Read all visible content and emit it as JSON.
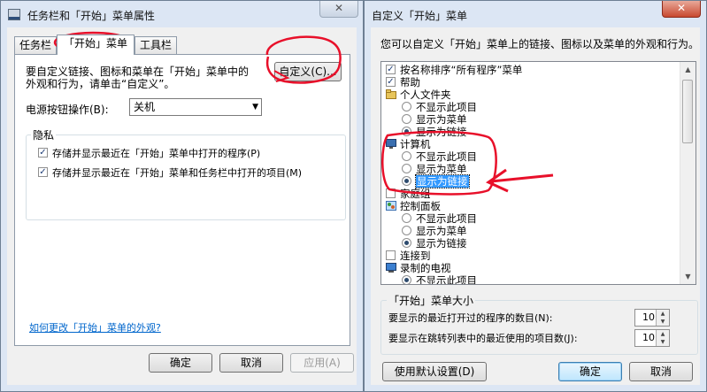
{
  "taskbar_props": {
    "title": "任务栏和「开始」菜单属性",
    "close": "✕",
    "tabs": [
      {
        "label": "任务栏",
        "active": false
      },
      {
        "label": "「开始」菜单",
        "active": true
      },
      {
        "label": "工具栏",
        "active": false
      }
    ],
    "customize_desc": "要自定义链接、图标和菜单在「开始」菜单中的外观和行为，请单击“自定义”。",
    "customize_desc_line1": "要自定义链接、图标和菜单在「开始」菜单中的",
    "customize_desc_line2": "外观和行为，请单击“自定义”。",
    "customize_button": "自定义(C)...",
    "power_label": "电源按钮操作(B):",
    "power_value": "关机",
    "privacy_group": "隐私",
    "privacy_items": [
      {
        "label": "存储并显示最近在「开始」菜单中打开的程序(P)",
        "checked": true
      },
      {
        "label": "存储并显示最近在「开始」菜单和任务栏中打开的项目(M)",
        "checked": true
      }
    ],
    "help_link": "如何更改「开始」菜单的外观?",
    "ok": "确定",
    "cancel": "取消",
    "apply": "应用(A)"
  },
  "customize_dialog": {
    "title": "自定义「开始」菜单",
    "close": "✕",
    "description": "您可以自定义「开始」菜单上的链接、图标以及菜单的外观和行为。",
    "items": [
      {
        "type": "checkbox",
        "label": "按名称排序“所有程序”菜单",
        "checked": true
      },
      {
        "type": "checkbox",
        "label": "帮助",
        "checked": true
      },
      {
        "type": "header",
        "label": "个人文件夹",
        "icon": "folder-icon"
      },
      {
        "type": "radio",
        "label": "不显示此项目",
        "checked": false
      },
      {
        "type": "radio",
        "label": "显示为菜单",
        "checked": false
      },
      {
        "type": "radio",
        "label": "显示为链接",
        "checked": true
      },
      {
        "type": "header",
        "label": "计算机",
        "icon": "computer-icon"
      },
      {
        "type": "radio",
        "label": "不显示此项目",
        "checked": false
      },
      {
        "type": "radio",
        "label": "显示为菜单",
        "checked": false
      },
      {
        "type": "radio",
        "label": "显示为链接",
        "checked": true,
        "selected": true
      },
      {
        "type": "checkbox",
        "label": "家庭组",
        "checked": false
      },
      {
        "type": "header",
        "label": "控制面板",
        "icon": "control-panel-icon"
      },
      {
        "type": "radio",
        "label": "不显示此项目",
        "checked": false
      },
      {
        "type": "radio",
        "label": "显示为菜单",
        "checked": false
      },
      {
        "type": "radio",
        "label": "显示为链接",
        "checked": true
      },
      {
        "type": "checkbox",
        "label": "连接到",
        "checked": false
      },
      {
        "type": "header",
        "label": "录制的电视",
        "icon": "tv-icon"
      },
      {
        "type": "radio",
        "label": "不显示此项目",
        "checked": true
      }
    ],
    "size_group": "「开始」菜单大小",
    "recent_programs_label": "要显示的最近打开过的程序的数目(N):",
    "recent_programs_value": "10",
    "jump_list_label": "要显示在跳转列表中的最近使用的项目数(J):",
    "jump_list_value": "10",
    "defaults_button": "使用默认设置(D)",
    "ok": "确定",
    "cancel": "取消"
  },
  "colors": {
    "window_frame": "#dce6f4",
    "selection": "#3399ff",
    "annotation": "#e8102a",
    "link": "#0066cc"
  }
}
